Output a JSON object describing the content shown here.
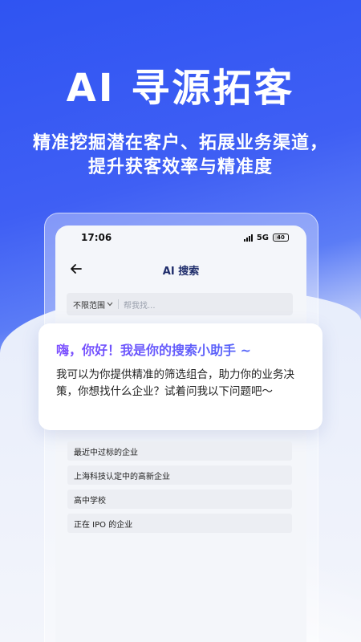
{
  "hero": {
    "title": "AI 寻源拓客",
    "subtitle_line1": "精准挖掘潜在客户、拓展业务渠道，",
    "subtitle_line2": "提升获客效率与精准度"
  },
  "status_bar": {
    "time": "17:06",
    "network": "5G",
    "battery": "40"
  },
  "nav": {
    "title": "AI 搜索"
  },
  "search": {
    "scope_label": "不限范围",
    "placeholder": "帮我找..."
  },
  "chat": {
    "greeting": "嗨，你好！我是你的搜索小助手 ~",
    "body": "我可以为你提供精准的筛选组合，助力你的业务决策，你想找什么企业？试着问我以下问题吧～"
  },
  "suggestions": [
    "最近中过标的企业",
    "上海科技认定中的高新企业",
    "高中学校",
    "正在 IPO 的企业"
  ],
  "colors": {
    "brand_blue": "#2f54f2",
    "greeting_gradient_start": "#7b4dff",
    "greeting_gradient_end": "#4a6cf7"
  }
}
